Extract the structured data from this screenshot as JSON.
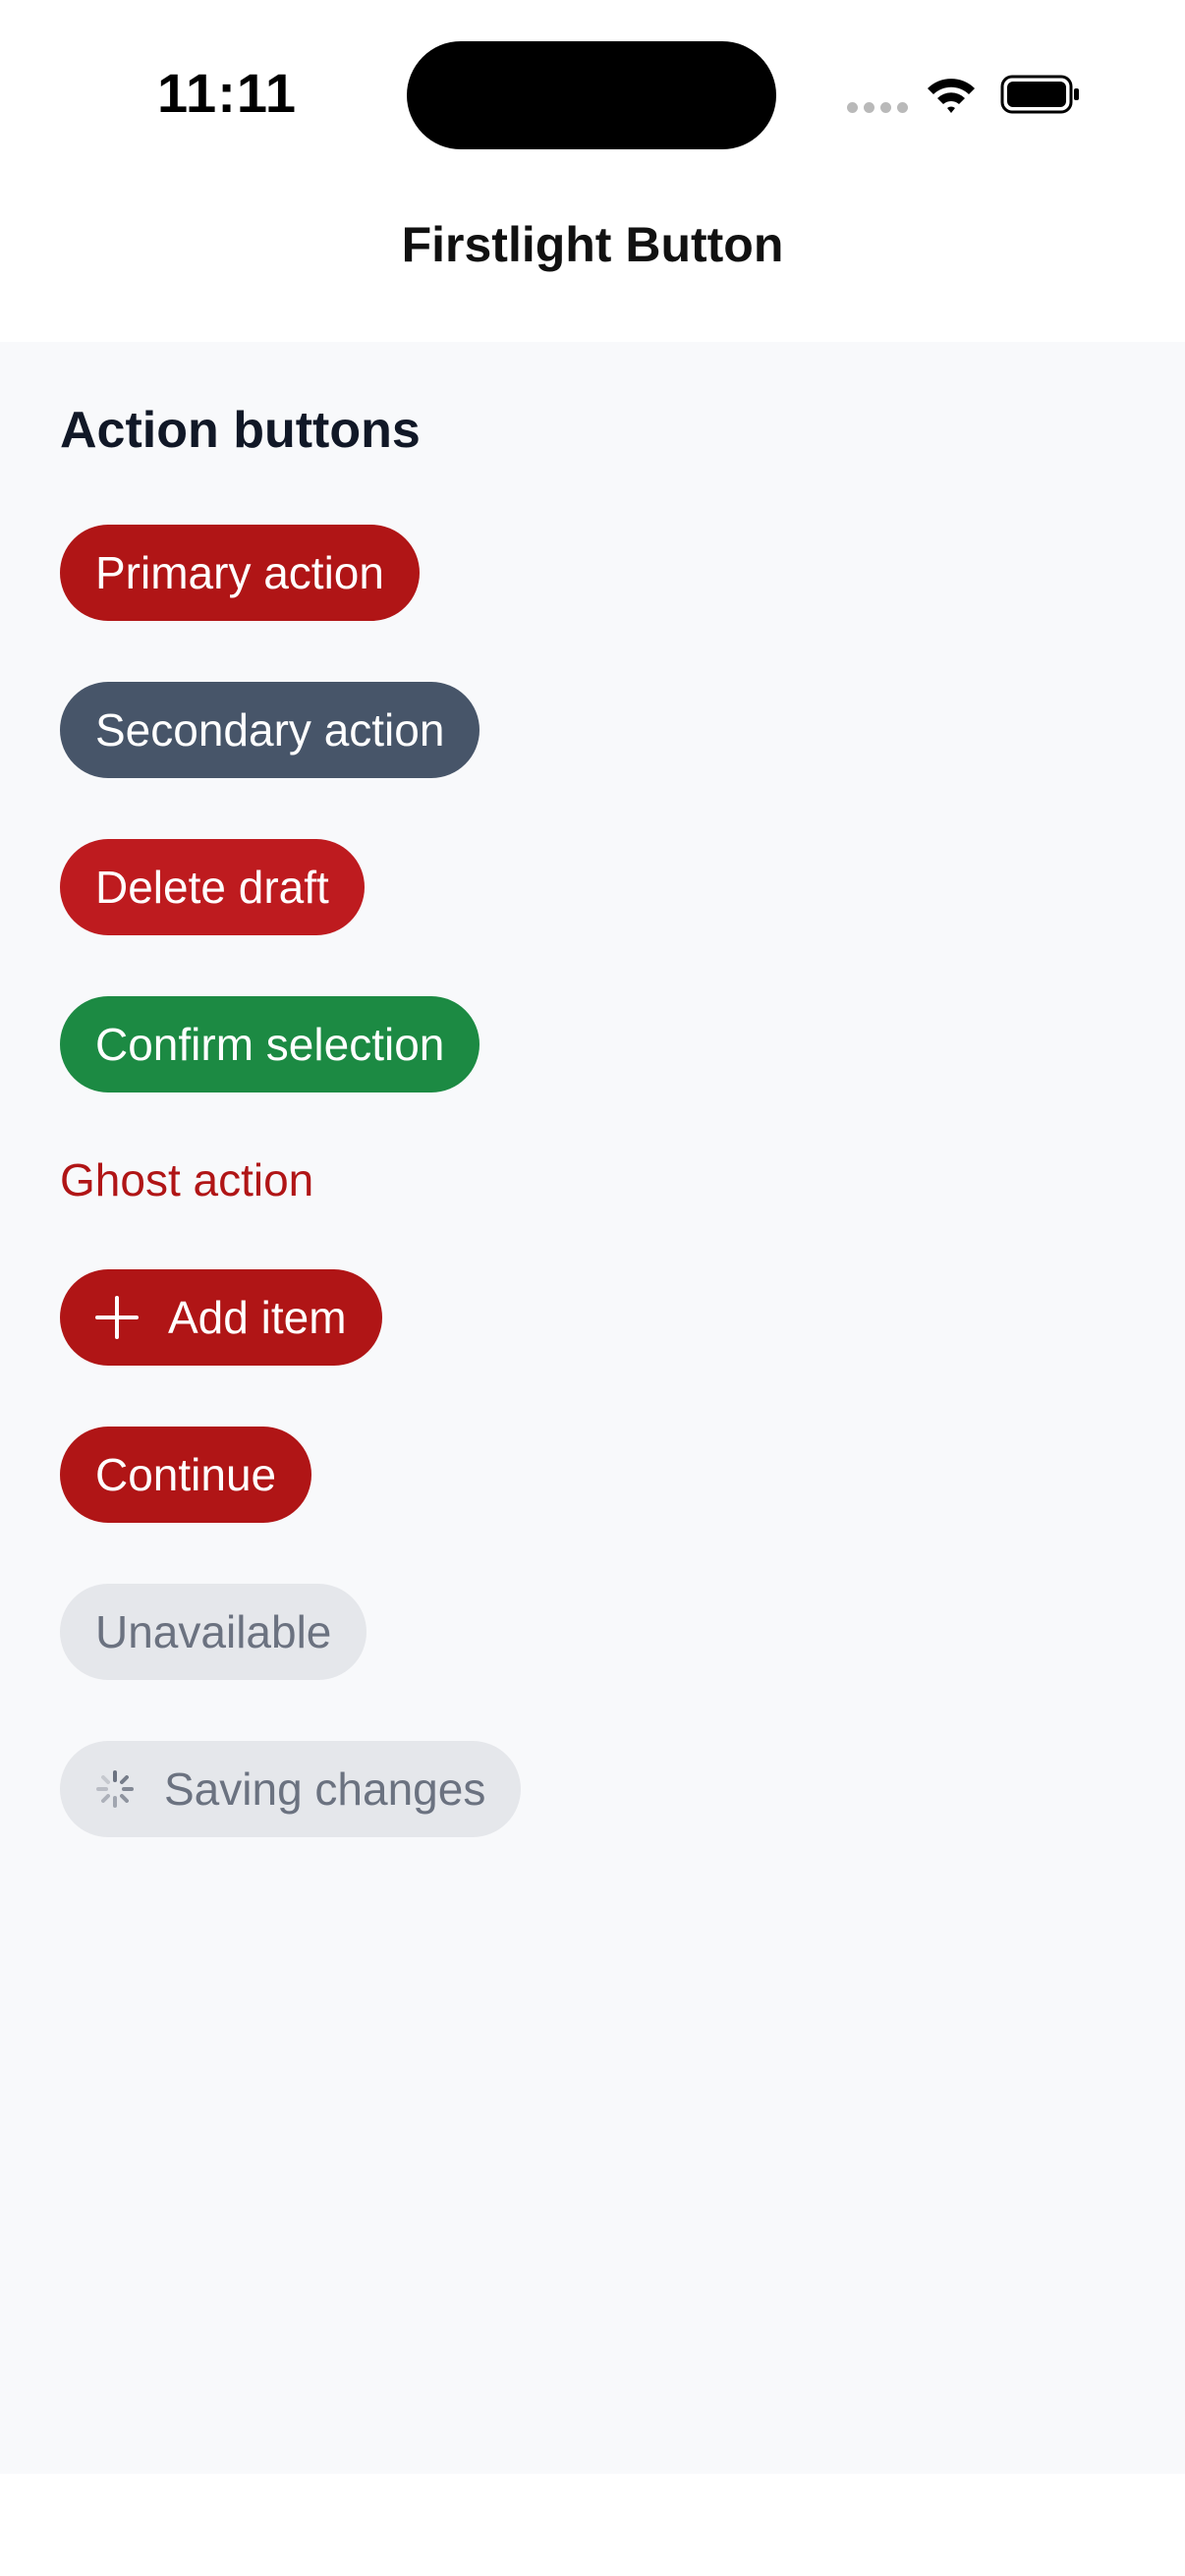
{
  "status_bar": {
    "time": "11:11",
    "icons": [
      "cellular-signal-icon",
      "wifi-icon",
      "battery-icon"
    ]
  },
  "nav": {
    "title": "Firstlight Button"
  },
  "section": {
    "title": "Action buttons"
  },
  "buttons": {
    "primary": "Primary action",
    "secondary": "Secondary action",
    "delete": "Delete draft",
    "confirm": "Confirm selection",
    "ghost": "Ghost action",
    "add": "Add item",
    "continue": "Continue",
    "unavailable": "Unavailable",
    "saving": "Saving changes"
  },
  "colors": {
    "primary": "#b01516",
    "secondary": "#475569",
    "danger": "#be1b1f",
    "success": "#1c8a43",
    "disabled_bg": "#e5e7eb",
    "disabled_text": "#6b7280",
    "content_bg": "#f8f9fb"
  }
}
